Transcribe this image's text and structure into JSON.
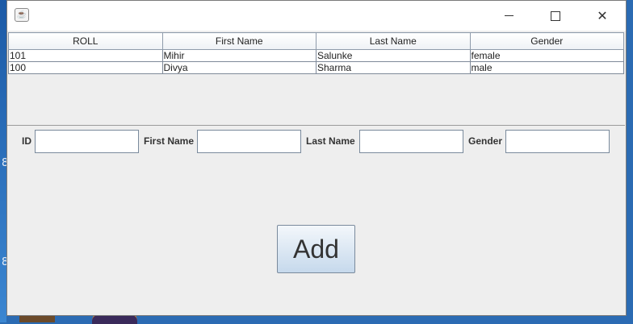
{
  "desktop": {
    "glyphs": [
      "8",
      "8"
    ]
  },
  "window": {
    "app_icon": "java-icon",
    "controls": {
      "minimize": "minimize-icon",
      "maximize": "maximize-icon",
      "close": "close-icon",
      "close_glyph": "✕"
    }
  },
  "table": {
    "columns": [
      "ROLL",
      "First Name",
      "Last Name",
      "Gender"
    ],
    "rows": [
      [
        "101",
        "Mihir",
        "Salunke",
        "female"
      ],
      [
        "100",
        "Divya",
        "Sharma",
        "male"
      ]
    ]
  },
  "form": {
    "id_label": "ID",
    "first_name_label": "First Name",
    "last_name_label": "Last Name",
    "gender_label": "Gender",
    "id_value": "",
    "first_name_value": "",
    "last_name_value": "",
    "gender_value": ""
  },
  "add_button": {
    "label": "Add"
  }
}
